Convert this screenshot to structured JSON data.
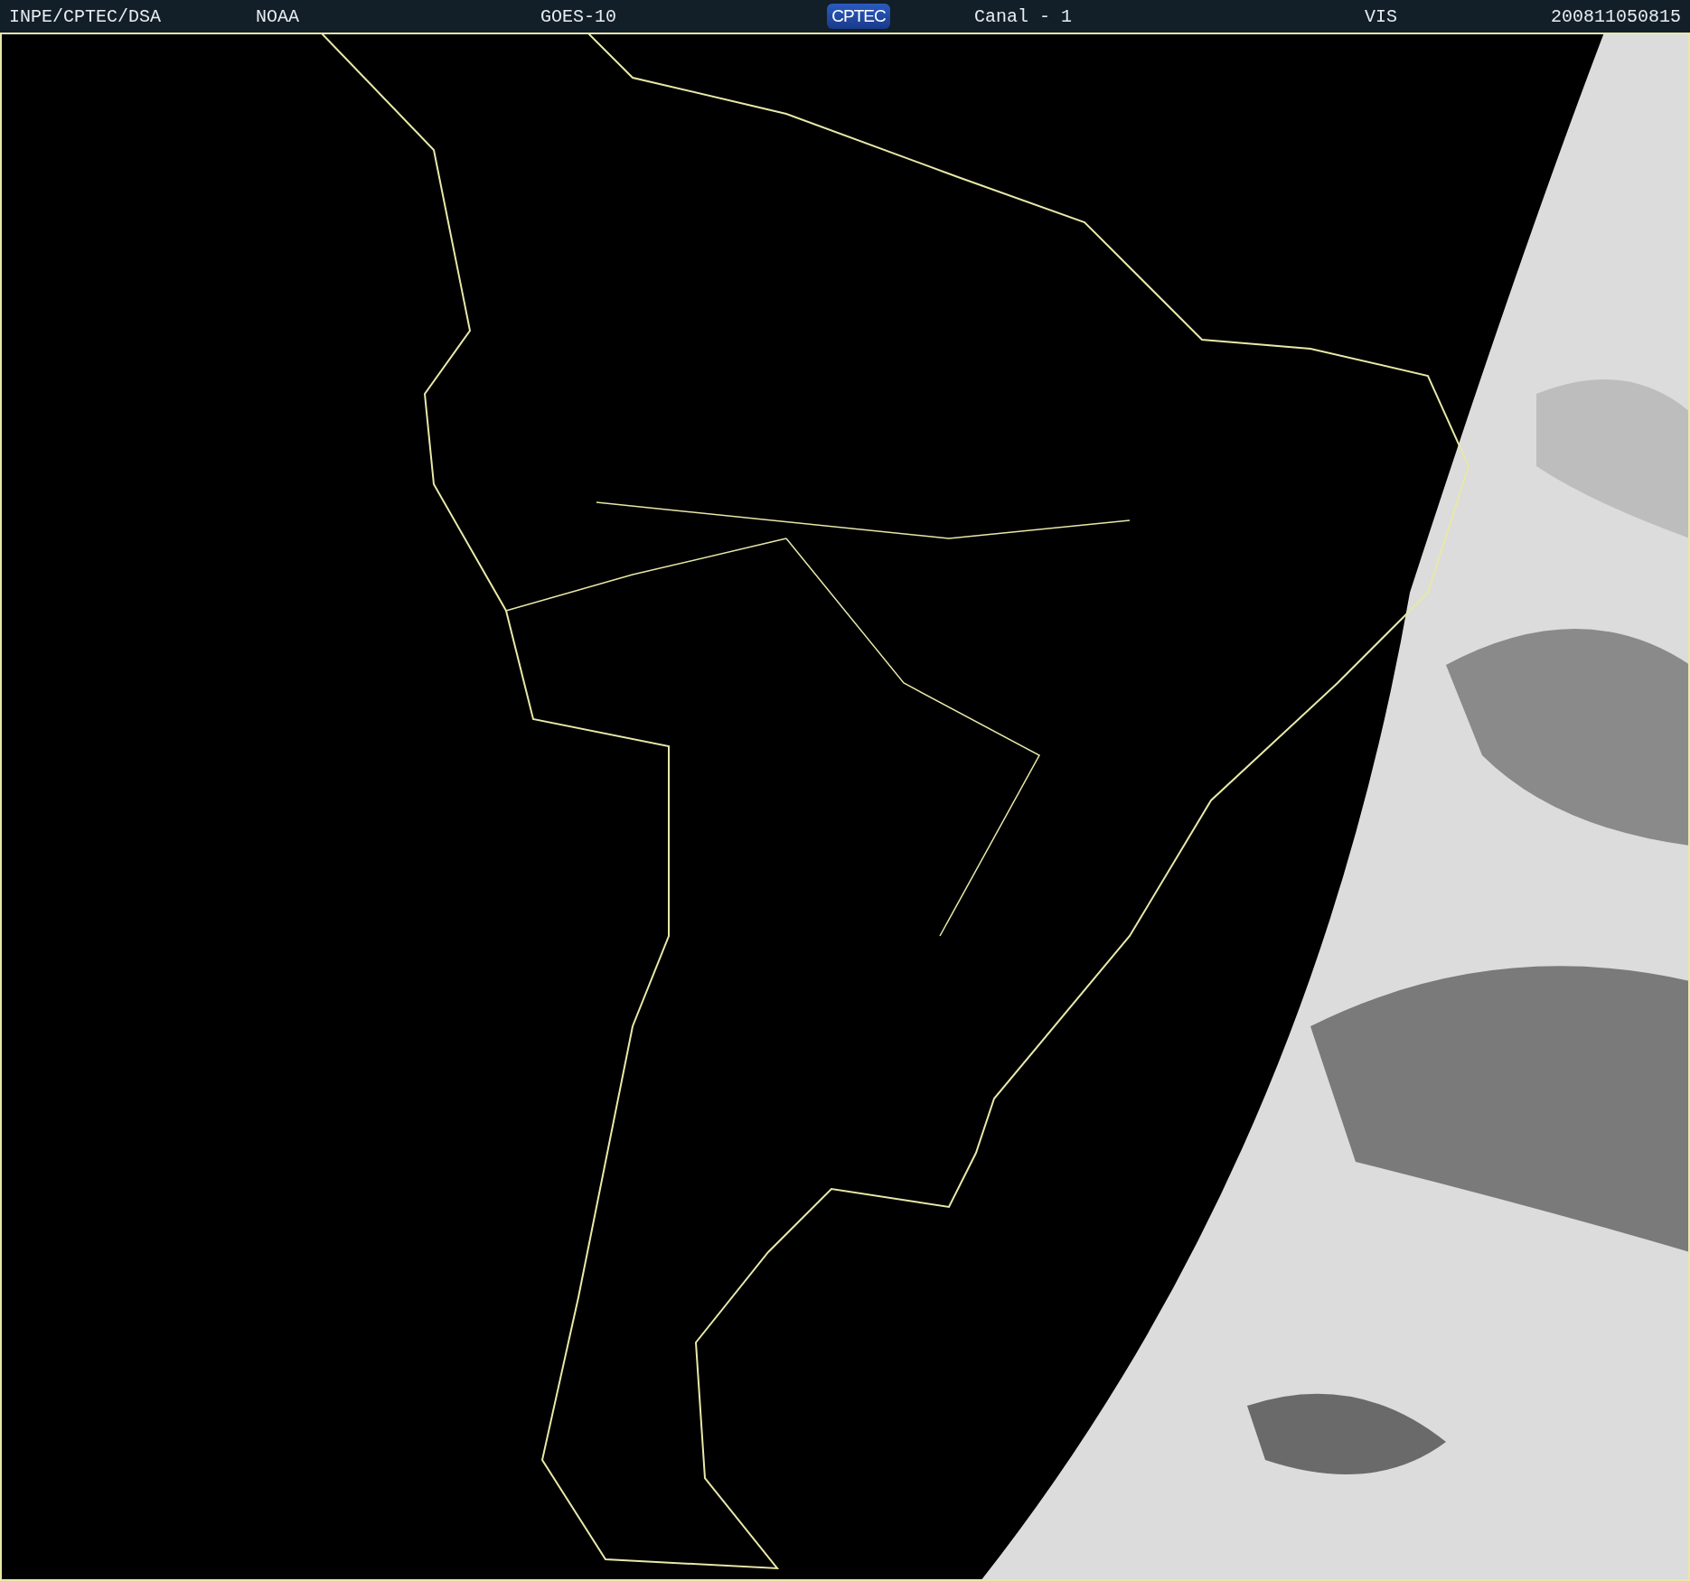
{
  "header": {
    "items": [
      {
        "kind": "text",
        "text": "INPE/CPTEC/DSA"
      },
      {
        "kind": "text",
        "text": "NOAA"
      },
      {
        "kind": "text",
        "text": "GOES-10"
      },
      {
        "kind": "logo",
        "text": "CPTEC"
      },
      {
        "kind": "text",
        "text": "Canal - 1"
      },
      {
        "kind": "text",
        "text": "VIS"
      },
      {
        "kind": "text",
        "text": "200811050815"
      }
    ]
  }
}
